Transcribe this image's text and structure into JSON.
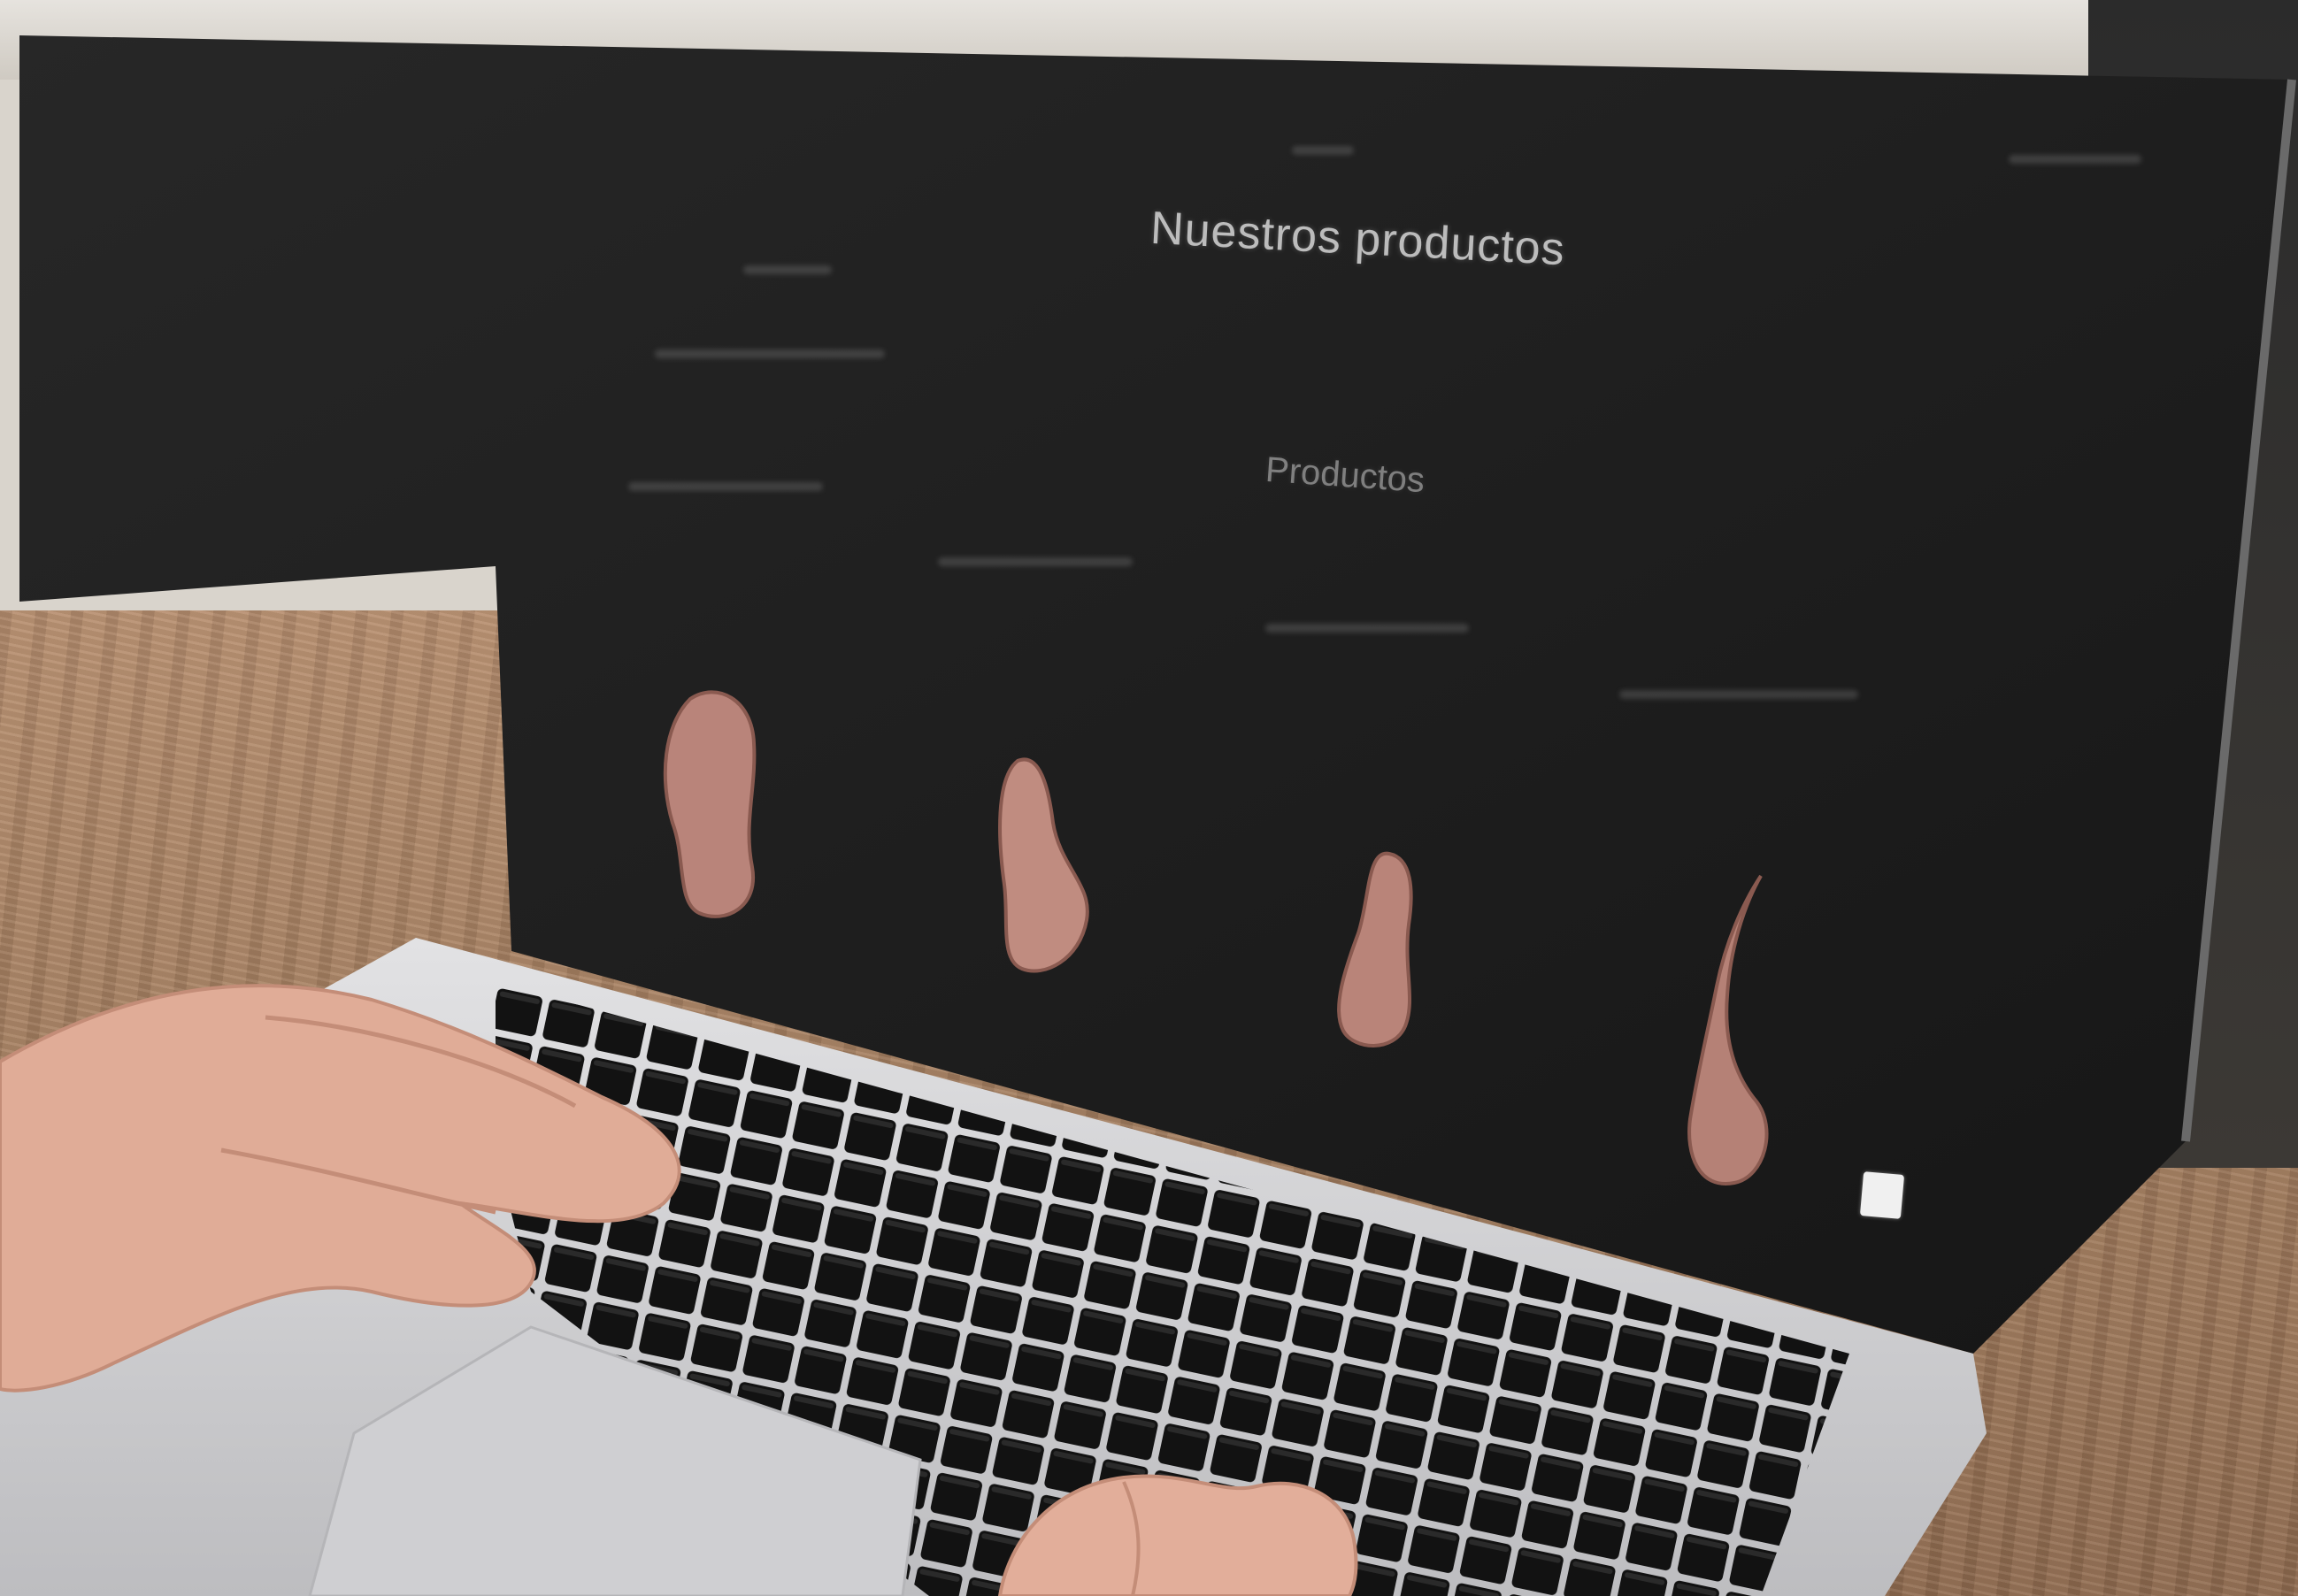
{
  "screen": {
    "title": "Nuestros productos",
    "subtitle": "Productos"
  },
  "products": [
    {
      "icon": "meat-cut-icon"
    },
    {
      "icon": "meat-cut-icon"
    },
    {
      "icon": "meat-cut-icon"
    },
    {
      "icon": "meat-cut-icon"
    }
  ],
  "colors": {
    "screen_bg": "#1f1f1f",
    "meat": "#b9847a",
    "laptop_body": "#d4d4d6",
    "keys": "#141414",
    "table": "#a37f62"
  }
}
